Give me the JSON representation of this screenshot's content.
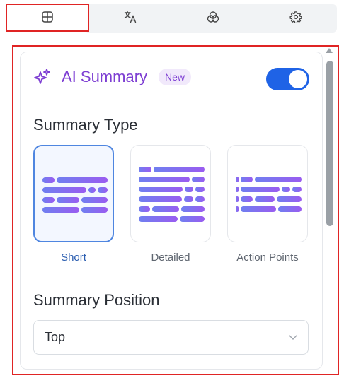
{
  "tabs": [
    {
      "icon": "grid-icon",
      "active": true
    },
    {
      "icon": "translate-icon",
      "active": false
    },
    {
      "icon": "circles-icon",
      "active": false
    },
    {
      "icon": "gear-icon",
      "active": false
    }
  ],
  "ai_summary": {
    "title": "AI Summary",
    "badge": "New",
    "enabled": true
  },
  "summary_type": {
    "heading": "Summary Type",
    "options": [
      {
        "label": "Short",
        "selected": true
      },
      {
        "label": "Detailed",
        "selected": false
      },
      {
        "label": "Action Points",
        "selected": false
      }
    ]
  },
  "summary_position": {
    "heading": "Summary Position",
    "value": "Top"
  },
  "colors": {
    "accent": "#7e3fd3",
    "toggle_on": "#1f63e6",
    "selected_border": "#4f86e0",
    "highlight": "#e02424"
  }
}
